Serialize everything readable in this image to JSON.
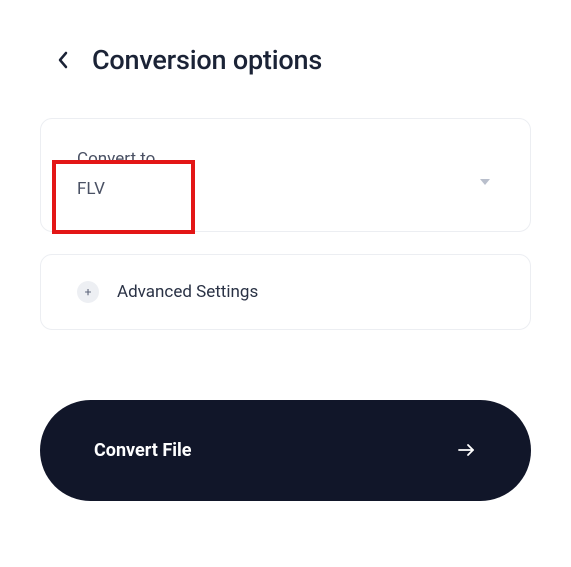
{
  "header": {
    "title": "Conversion options"
  },
  "convert": {
    "label": "Convert to",
    "selected_value": "FLV"
  },
  "advanced": {
    "label": "Advanced Settings",
    "plus_glyph": "+"
  },
  "action": {
    "convert_button_label": "Convert File"
  },
  "colors": {
    "text_primary": "#1b2336",
    "text_secondary": "#4a5164",
    "highlight": "#e31616",
    "button_bg": "#111629"
  }
}
